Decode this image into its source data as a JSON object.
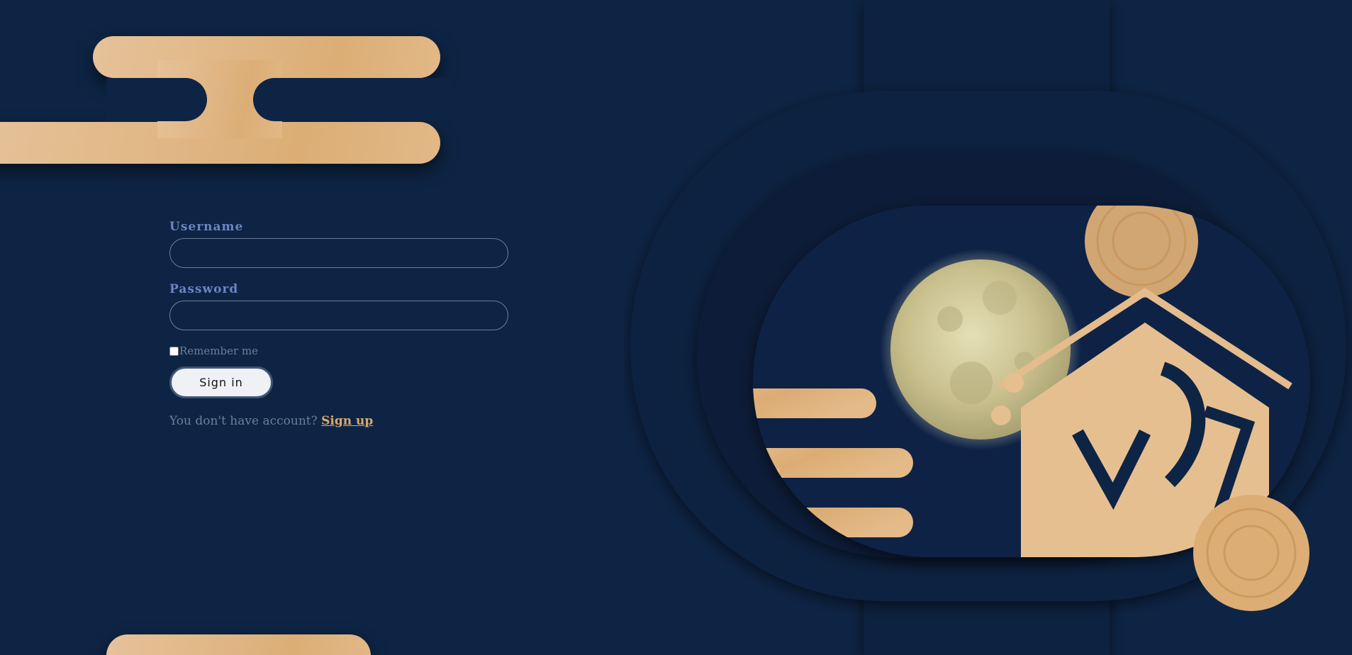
{
  "form": {
    "username_label": "Username",
    "username_value": "",
    "password_label": "Password",
    "password_value": "",
    "remember_label": "Remember me",
    "remember_checked": false,
    "signin_label": "Sign in",
    "signup_prompt": "You don't have account?",
    "signup_link": "Sign up"
  },
  "theme": {
    "background": "#0e2444",
    "accent_gold": "#dcae76",
    "label_blue": "#6a86c4",
    "muted_text": "#6b7f9a"
  },
  "artwork": {
    "icons": [
      "cloud-decoration",
      "moon",
      "mooncake",
      "lantern-arch",
      "logo-emblem"
    ]
  }
}
